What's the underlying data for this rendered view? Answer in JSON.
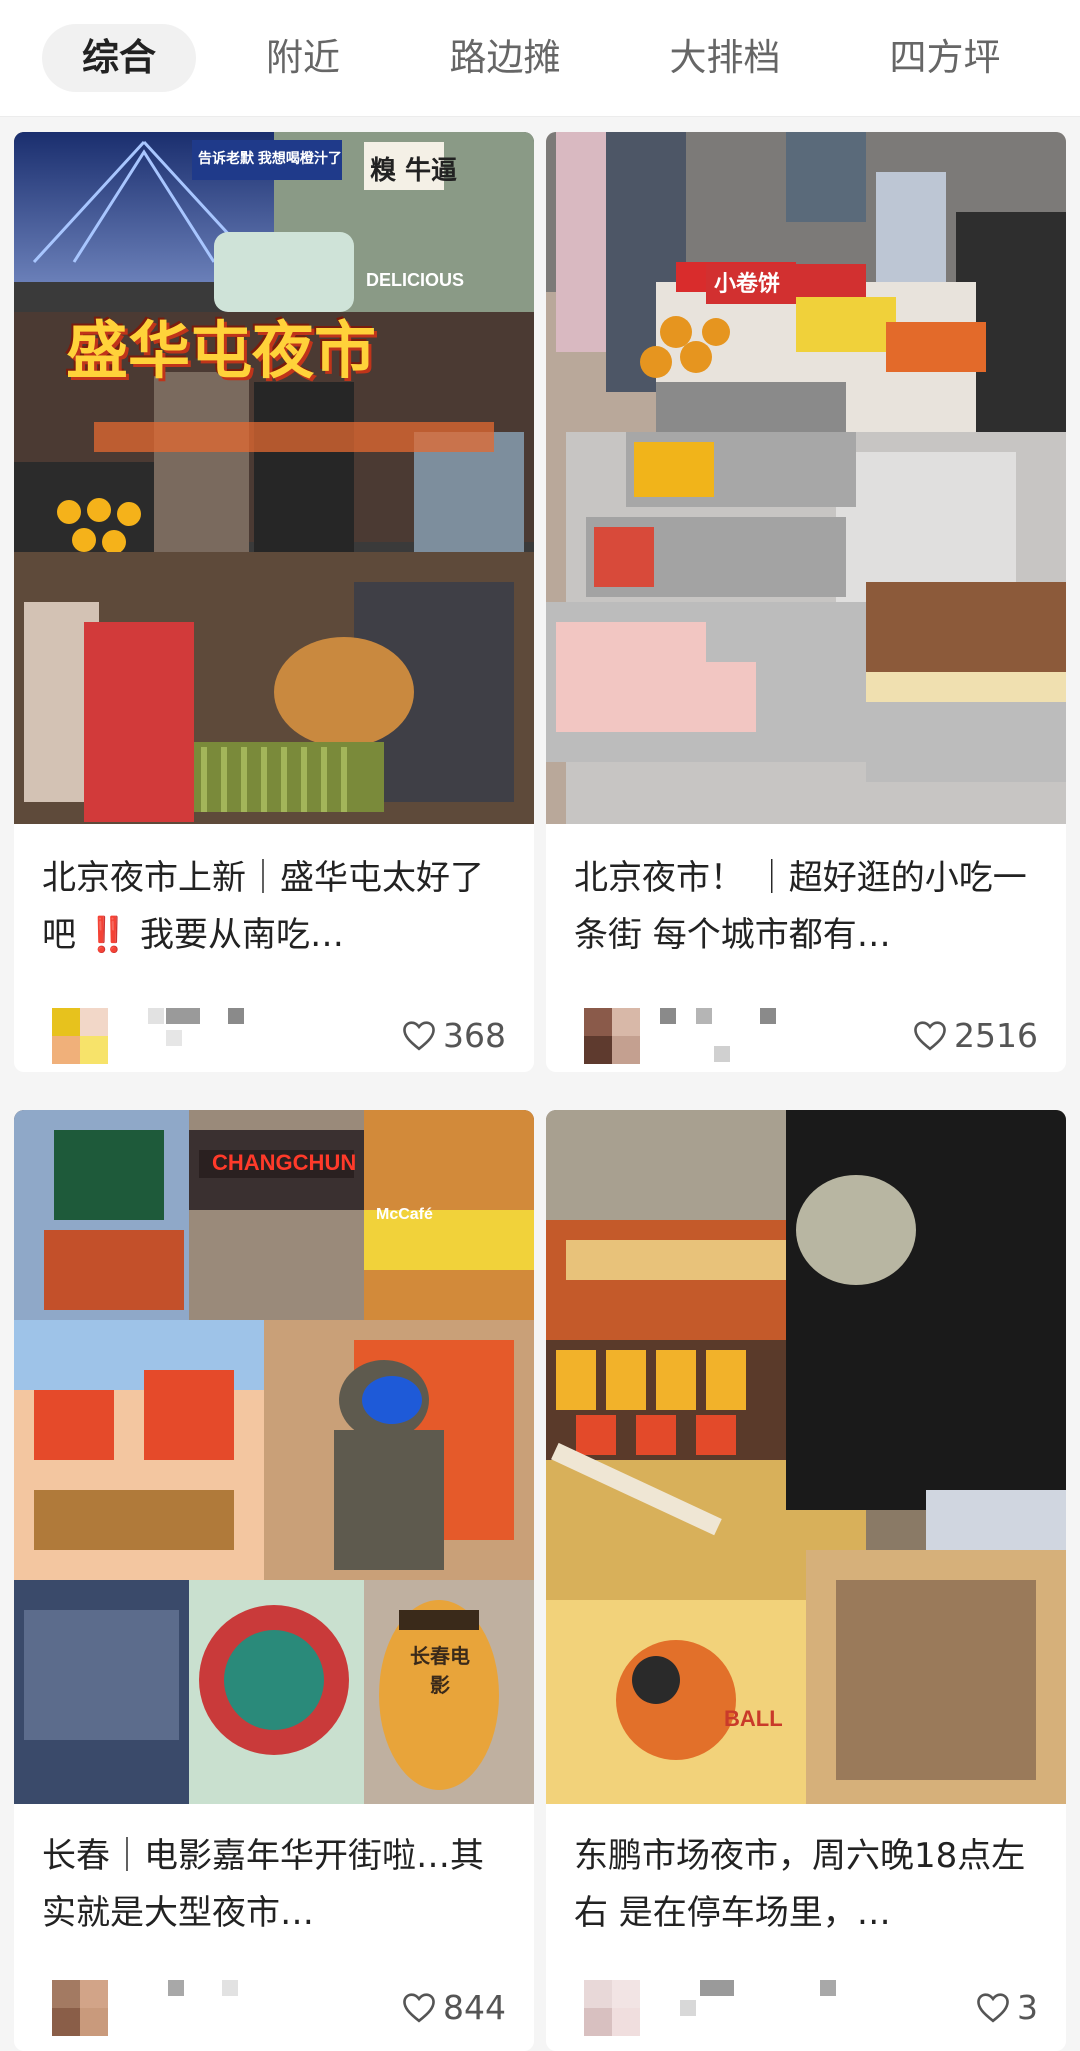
{
  "tabs": [
    {
      "label": "综合",
      "active": true
    },
    {
      "label": "附近",
      "active": false
    },
    {
      "label": "路边摊",
      "active": false
    },
    {
      "label": "大排档",
      "active": false
    },
    {
      "label": "四方坪",
      "active": false
    }
  ],
  "cards": [
    {
      "title": "北京夜市上新｜盛华屯太好了吧 ‼️ 我要从南吃…",
      "likes": "368",
      "image_text": {
        "headline": "盛华屯夜市",
        "badge": "DELICIOUS",
        "sign": "告诉老默 我想喝橙汁了",
        "vertical": "糗 牛逼"
      }
    },
    {
      "title": "北京夜市！ ｜超好逛的小吃一条街 每个城市都有…",
      "likes": "2516",
      "image_text": {
        "sign": "小卷饼"
      }
    },
    {
      "title": "长春｜电影嘉年华开街啦…其实就是大型夜市…",
      "likes": "844",
      "image_text": {
        "sign": "CHANGCHUN",
        "cafe": "McCafé",
        "lantern": "长春电影"
      }
    },
    {
      "title": "东鹏市场夜市，周六晚18点左右 是在停车场里，…",
      "likes": "3",
      "image_text": {
        "poster": "BALL"
      }
    }
  ],
  "colors": {
    "accent_red": "#e0261b",
    "text": "#222222",
    "muted": "#666666",
    "bg": "#f5f5f5"
  },
  "icons": {
    "like": "heart-outline-icon"
  }
}
